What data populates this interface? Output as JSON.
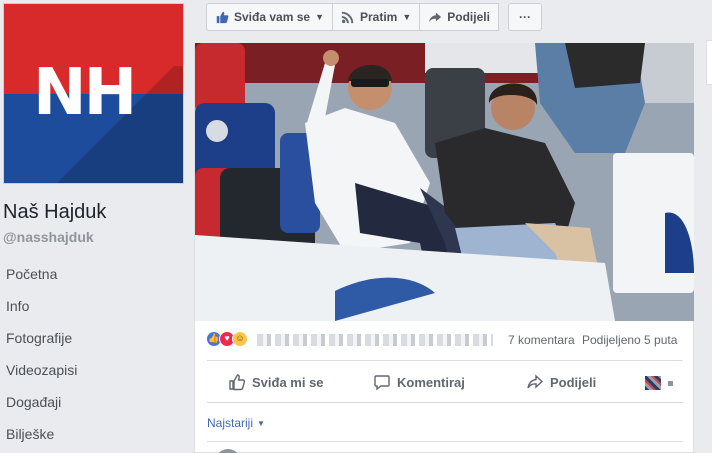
{
  "profile": {
    "logo_text": "NH",
    "name": "Naš Hajduk",
    "handle": "@nasshajduk"
  },
  "nav": {
    "items": [
      {
        "label": "Početna"
      },
      {
        "label": "Info"
      },
      {
        "label": "Fotografije"
      },
      {
        "label": "Videozapisi"
      },
      {
        "label": "Događaji"
      },
      {
        "label": "Bilješke"
      }
    ]
  },
  "actions": {
    "like_label": "Sviđa vam se",
    "follow_label": "Pratim",
    "share_label": "Podijeli",
    "more_label": "···"
  },
  "post": {
    "reactions": [
      "like",
      "love",
      "haha"
    ],
    "comments_count": "7 komentara",
    "shares_count": "Podijeljeno 5 puta",
    "buttons": {
      "like": "Sviđa mi se",
      "comment": "Komentiraj",
      "share": "Podijeli"
    },
    "sort_label": "Najstariji"
  },
  "colors": {
    "fb_blue": "#4267b2",
    "nh_red": "#d82a2a",
    "nh_blue": "#1e4c9c",
    "background": "#e9ebee"
  }
}
